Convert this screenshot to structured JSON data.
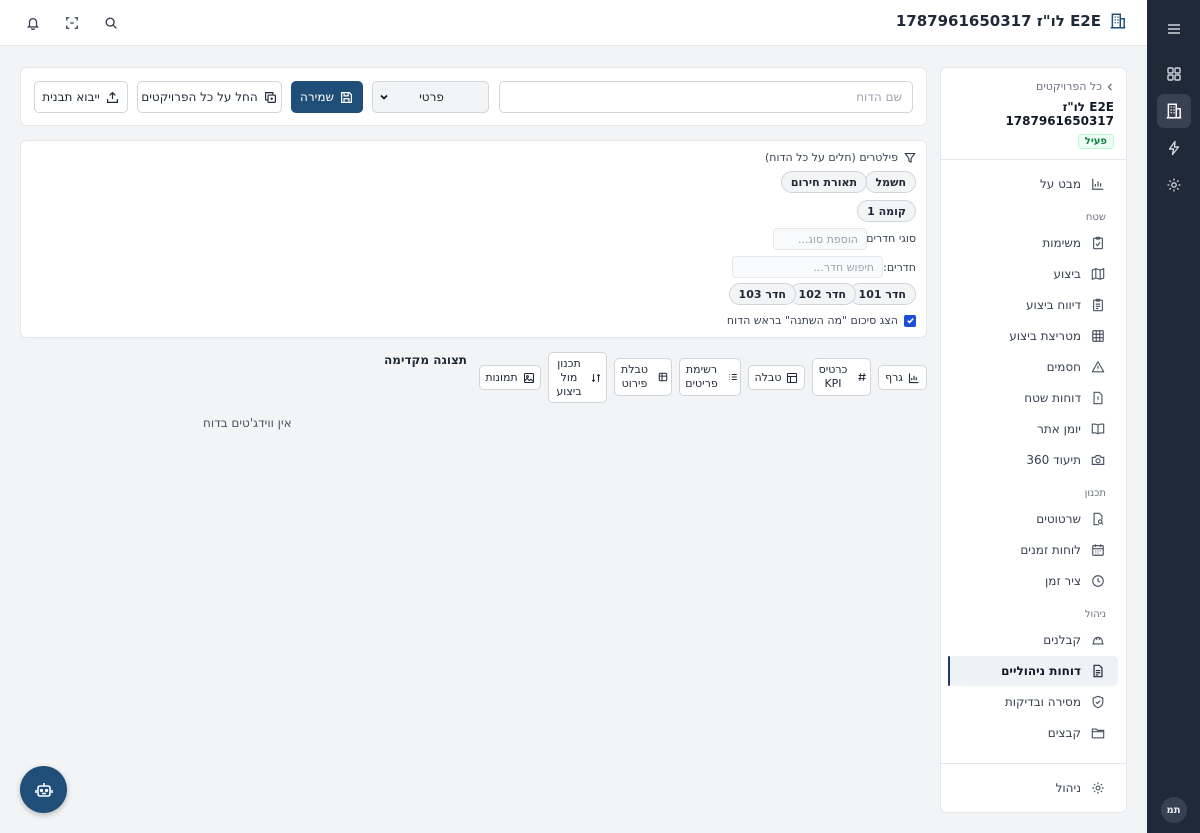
{
  "app": {
    "project_title": "E2E לו\"ז 1787961650317",
    "user_initials": "תמ"
  },
  "sidebar": {
    "breadcrumb": "כל הפרויקטים",
    "project_name": "E2E לו\"ז 1787961650317",
    "status": "פעיל",
    "overview": "מבט על",
    "sections": {
      "field": "שטח",
      "planning": "תכנון",
      "management": "ניהול"
    },
    "field_items": [
      "משימות",
      "ביצוע",
      "דיווח ביצוע",
      "מטריצת ביצוע",
      "חסמים",
      "דוחות שטח",
      "יומן אתר",
      "תיעוד 360"
    ],
    "planning_items": [
      "שרטוטים",
      "לוחות זמנים",
      "ציר זמן"
    ],
    "management_items": [
      "קבלנים",
      "דוחות ניהוליים",
      "מסירה ובדיקות",
      "קבצים"
    ],
    "settings": "ניהול"
  },
  "toolbar": {
    "report_name_placeholder": "שם הדוח",
    "scope_value": "פרטי",
    "save_label": "שמירה",
    "apply_all_label": "החל על כל הפרויקטים",
    "import_label": "ייבוא תבנית"
  },
  "filters": {
    "title": "פילטרים (חלים על כל הדוח)",
    "trade_chips": [
      "חשמל",
      "תאורת חירום"
    ],
    "floor_chips": [
      "קומה 1"
    ],
    "room_types_label": "סוגי חדרים:",
    "room_types_placeholder": "הוספת סוג...",
    "rooms_label": "חדרים:",
    "rooms_placeholder": "חיפוש חדר...",
    "room_chips": [
      "חדר 101",
      "חדר 102",
      "חדר 103"
    ],
    "summary_checkbox_label": "הצג סיכום \"מה השתנה\" בראש הדוח",
    "summary_checked": true
  },
  "palette": {
    "title": "תצוגה מקדימה",
    "chart": "גרף",
    "kpi": "כרטיס KPI",
    "table": "טבלה",
    "items_list": "רשימת פריטים",
    "pivot": "טבלת פירוט",
    "plan_vs_exec": "תכנון מול ביצוע",
    "photos": "תמונות"
  },
  "preview": {
    "empty_message": "אין ווידג'טים בדוח"
  },
  "colors": {
    "rail_bg": "#1f2937",
    "primary": "#1f4e79",
    "active_badge": "#15803d"
  }
}
